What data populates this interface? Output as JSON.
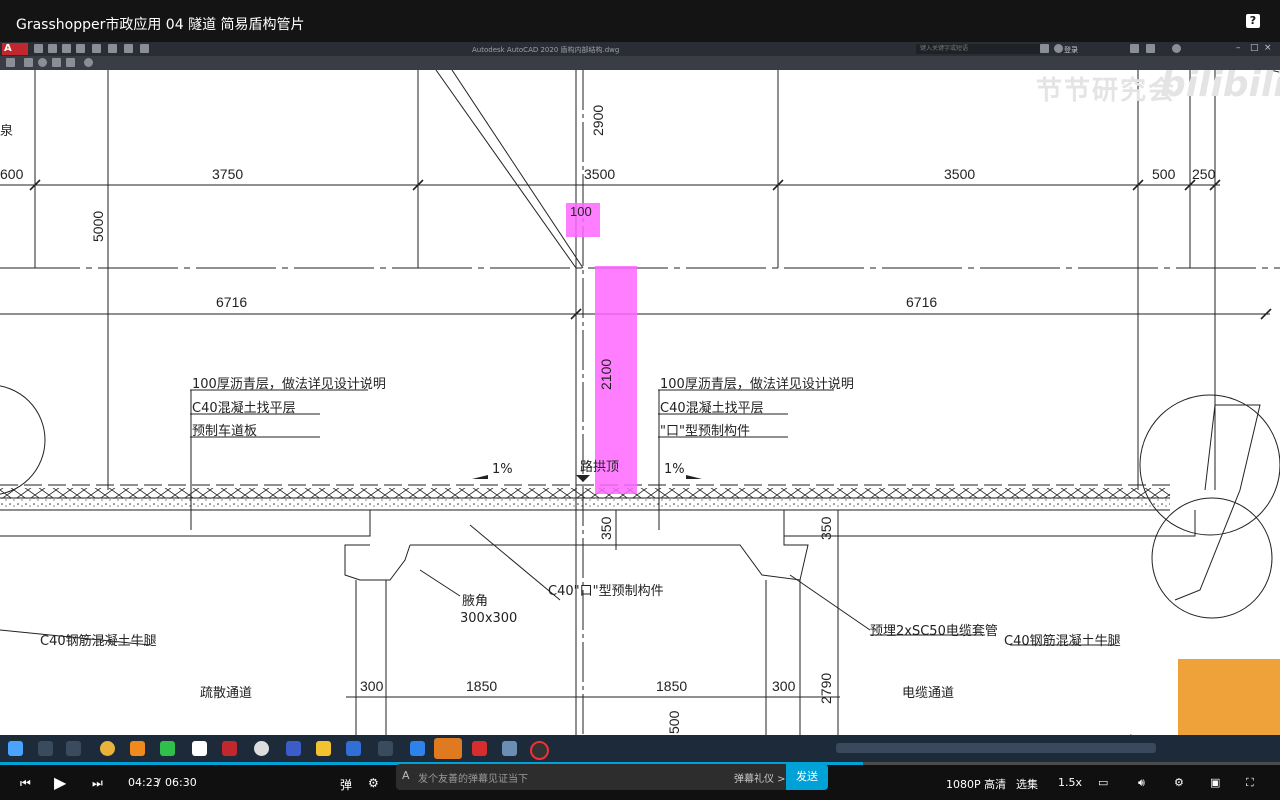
{
  "video": {
    "title": "Grasshopper市政应用 04 隧道 简易盾构管片",
    "help": "?"
  },
  "acad": {
    "logo": "A",
    "title": "Autodesk AutoCAD 2020    盾构内部结构.dwg",
    "search_placeholder": "键入关键字或短语",
    "login": "登录"
  },
  "drawing": {
    "dims_top": [
      "600",
      "3750",
      "3500",
      "3500",
      "500",
      "250"
    ],
    "dim_100": "100",
    "dims_mid": [
      "6716",
      "6716"
    ],
    "vertical_dims": [
      "2900",
      "5000",
      "2100",
      "350",
      "350",
      "2790",
      "500"
    ],
    "left_notes": [
      "100厚沥青层，做法详见设计说明",
      "C40混凝土找平层",
      "预制车道板"
    ],
    "right_notes": [
      "100厚沥青层，做法详见设计说明",
      "C40混凝土找平层",
      "\"口\"型预制构件"
    ],
    "slope_left": "1%",
    "slope_right": "1%",
    "crown_label": "路拱顶",
    "center_component": "C40\"口\"型预制构件",
    "haunch_label": "腋角",
    "haunch_size": "300x300",
    "cable_label": "预埋2xSC50电缆套管",
    "corbel_left": "C40钢筋混凝土牛腿",
    "corbel_right": "C40钢筋混凝土牛腿",
    "dims_bottom": [
      "300",
      "1850",
      "1850",
      "300"
    ],
    "evac_label": "疏散通道",
    "cable_channel_label": "电缆通道",
    "edge_label": "泉"
  },
  "watermark": {
    "text": "节节研究会",
    "brand": "bilibili"
  },
  "player": {
    "current_time": "04:23",
    "separator": "/",
    "duration": "06:30",
    "progress": 0.674,
    "danmaku_placeholder": "发个友善的弹幕见证当下",
    "danmaku_etiquette": "弹幕礼仪 >",
    "send": "发送",
    "quality": "1080P 高清",
    "episodes": "选集",
    "speed": "1.5x"
  },
  "colors": {
    "highlight": "#ff66ff",
    "accent": "#00a1d6",
    "acad_red": "#c0282d"
  }
}
